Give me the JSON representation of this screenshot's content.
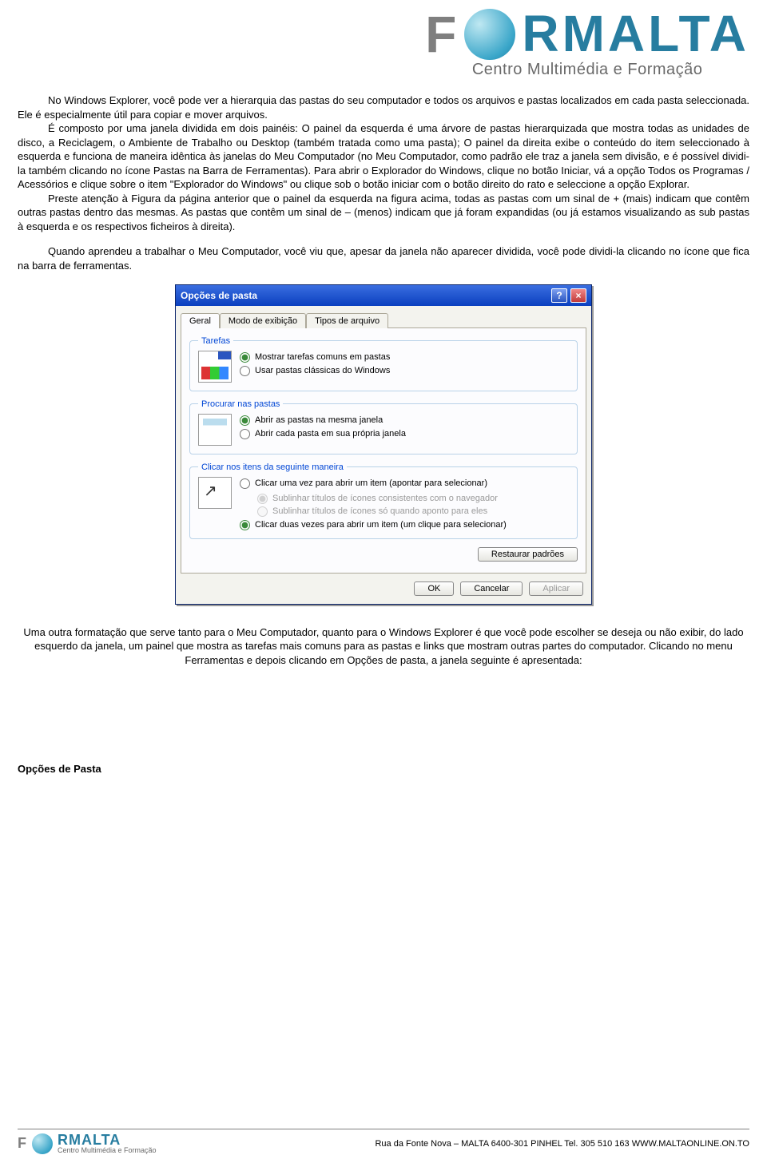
{
  "brand": {
    "prefix": "F",
    "suffix": "RMALTA",
    "sub": "Centro Multimédia e Formação"
  },
  "paras": {
    "p1": "No Windows Explorer, você pode ver a hierarquia das pastas do seu computador e todos os arquivos e pastas localizados em cada pasta seleccionada. Ele é especialmente útil para copiar e mover arquivos.",
    "p2": "É composto por uma janela dividida em dois painéis: O painel da esquerda é uma árvore de pastas hierarquizada que mostra todas as unidades de disco, a Reciclagem, o Ambiente de Trabalho ou Desktop (também tratada como uma pasta); O painel da direita exibe o conteúdo do item seleccionado à esquerda e funciona de maneira idêntica às janelas do Meu Computador (no Meu Computador, como padrão ele traz a janela sem divisão, e é possível dividi-la também clicando no ícone Pastas na Barra de Ferramentas). Para abrir o Explorador do Windows, clique no botão Iniciar, vá a opção Todos os Programas / Acessórios e clique sobre o item \"Explorador do Windows\" ou clique sob o botão iniciar com o botão direito do rato e seleccione a opção Explorar.",
    "p3": "Preste atenção à Figura da página anterior que o painel da esquerda na figura acima, todas as pastas com um sinal de + (mais) indicam que contêm outras pastas dentro das mesmas. As pastas que contêm um sinal de – (menos) indicam que já foram expandidas (ou já estamos visualizando as sub pastas à esquerda e os respectivos ficheiros à direita).",
    "p4": "Quando aprendeu a trabalhar o Meu Computador, você viu que, apesar da janela não aparecer dividida, você pode dividi-la clicando no ícone que fica na barra de ferramentas.",
    "p5": "Uma outra formatação que serve tanto para o Meu Computador, quanto para o Windows Explorer é que você pode escolher se deseja ou não exibir, do lado esquerdo da janela, um painel que mostra as tarefas mais comuns para as pastas e links que mostram outras partes do computador. Clicando no menu Ferramentas e depois clicando em Opções de pasta, a janela seguinte é apresentada:"
  },
  "dialog": {
    "title": "Opções de pasta",
    "tabs": [
      "Geral",
      "Modo de exibição",
      "Tipos de arquivo"
    ],
    "groups": {
      "tarefas": {
        "legend": "Tarefas",
        "o1": "Mostrar tarefas comuns em pastas",
        "o2": "Usar pastas clássicas do Windows"
      },
      "procurar": {
        "legend": "Procurar nas pastas",
        "o1": "Abrir as pastas na mesma janela",
        "o2": "Abrir cada pasta em sua própria janela"
      },
      "clicar": {
        "legend": "Clicar nos itens da seguinte maneira",
        "o1": "Clicar uma vez para abrir um item (apontar para selecionar)",
        "s1": "Sublinhar títulos de ícones consistentes com o navegador",
        "s2": "Sublinhar títulos de ícones só quando aponto para eles",
        "o2": "Clicar duas vezes para abrir um item (um clique para selecionar)"
      }
    },
    "buttons": {
      "restore": "Restaurar padrões",
      "ok": "OK",
      "cancel": "Cancelar",
      "apply": "Aplicar"
    }
  },
  "section_title": "Opções de Pasta",
  "footer": {
    "addr": "Rua da Fonte Nova – MALTA 6400-301 PINHEL Tel. 305 510 163 WWW.MALTAONLINE.ON.TO"
  }
}
